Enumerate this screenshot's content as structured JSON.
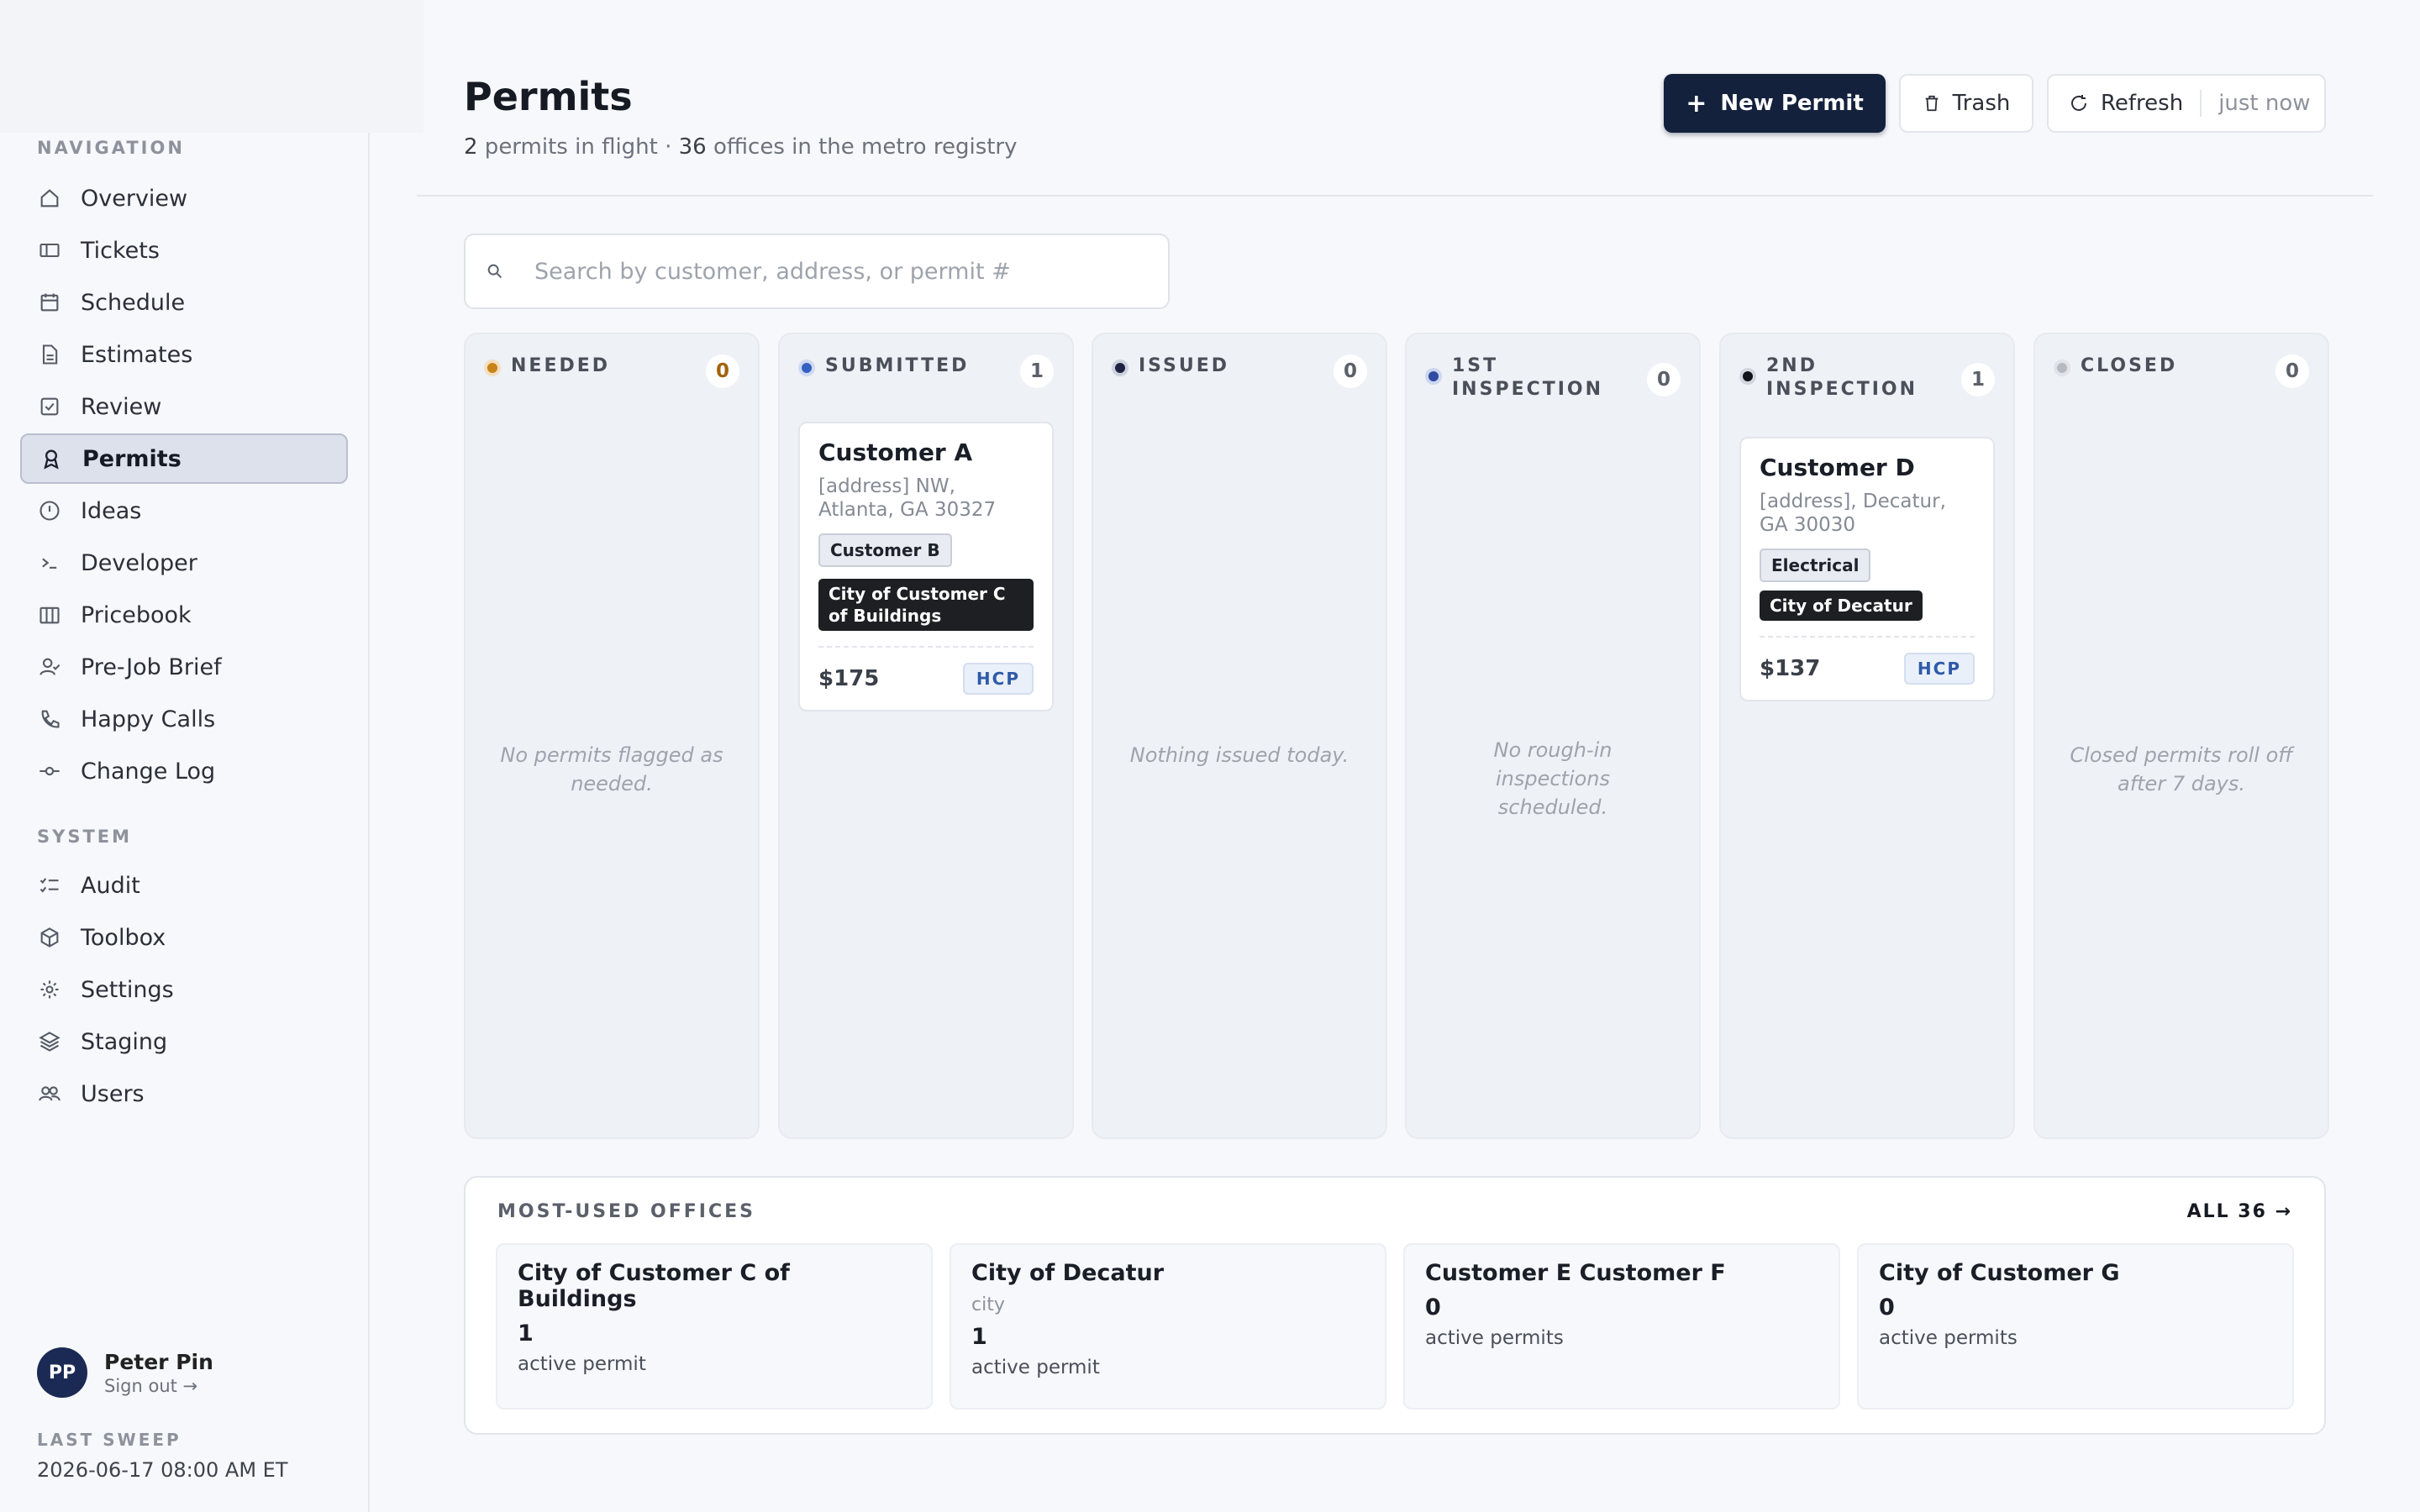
{
  "sidebar": {
    "nav_heading": "NAVIGATION",
    "items": [
      {
        "label": "Overview",
        "icon": "home-icon"
      },
      {
        "label": "Tickets",
        "icon": "ticket-icon"
      },
      {
        "label": "Schedule",
        "icon": "calendar-icon"
      },
      {
        "label": "Estimates",
        "icon": "document-icon"
      },
      {
        "label": "Review",
        "icon": "checkbox-icon"
      },
      {
        "label": "Permits",
        "icon": "badge-icon"
      },
      {
        "label": "Ideas",
        "icon": "clock-icon"
      },
      {
        "label": "Developer",
        "icon": "terminal-icon"
      },
      {
        "label": "Pricebook",
        "icon": "book-icon"
      },
      {
        "label": "Pre-Job Brief",
        "icon": "user-check-icon"
      },
      {
        "label": "Happy Calls",
        "icon": "phone-icon"
      },
      {
        "label": "Change Log",
        "icon": "commit-icon"
      }
    ],
    "system_heading": "SYSTEM",
    "system_items": [
      {
        "label": "Audit",
        "icon": "list-check-icon"
      },
      {
        "label": "Toolbox",
        "icon": "box-icon"
      },
      {
        "label": "Settings",
        "icon": "sun-gear-icon"
      },
      {
        "label": "Staging",
        "icon": "layers-icon"
      },
      {
        "label": "Users",
        "icon": "users-icon"
      }
    ],
    "active_item": "Permits",
    "user": {
      "initials": "PP",
      "name": "Peter Pin",
      "signout": "Sign out →"
    },
    "last_sweep_label": "LAST SWEEP",
    "last_sweep_value": "2026-06-17 08:00 AM ET"
  },
  "header": {
    "title": "Permits",
    "subtitle_count_permits": "2",
    "subtitle_mid": " permits in flight · ",
    "subtitle_count_offices": "36",
    "subtitle_end": " offices in the metro registry",
    "new_button": "New Permit",
    "trash_button": "Trash",
    "refresh_button": "Refresh",
    "refresh_status": "just now"
  },
  "search": {
    "placeholder": "Search by customer, address, or permit #"
  },
  "columns": [
    {
      "title": "NEEDED",
      "count": "0",
      "dot_color": "#c9821a",
      "count_color": "#a3620c",
      "empty": "No permits flagged as needed."
    },
    {
      "title": "SUBMITTED",
      "count": "1",
      "dot_color": "#3461c1",
      "count_color": "#5b606a"
    },
    {
      "title": "ISSUED",
      "count": "0",
      "dot_color": "#1b2340",
      "count_color": "#5b606a",
      "empty": "Nothing issued today."
    },
    {
      "title": "1ST INSPECTION",
      "count": "0",
      "dot_color": "#2f4aa0",
      "count_color": "#5b606a",
      "empty": "No rough-in inspections scheduled."
    },
    {
      "title": "2ND INSPECTION",
      "count": "1",
      "dot_color": "#111318",
      "count_color": "#5b606a"
    },
    {
      "title": "CLOSED",
      "count": "0",
      "dot_color": "#b5b9c1",
      "count_color": "#5b606a",
      "empty": "Closed permits roll off after 7 days."
    }
  ],
  "cards": [
    {
      "customer": "Customer A",
      "address": "[address] NW, Atlanta, GA 30327",
      "tag_light": "Customer B",
      "tag_dark": "City of Customer C of Buildings",
      "price": "$175",
      "source": "HCP"
    },
    {
      "customer": "Customer D",
      "address": "[address], Decatur, GA 30030",
      "tag_light": "Electrical",
      "tag_dark": "City of Decatur",
      "price": "$137",
      "source": "HCP"
    }
  ],
  "offices": {
    "label": "MOST-USED OFFICES",
    "all_link": "ALL 36 →",
    "items": [
      {
        "name": "City of Customer C of Buildings",
        "type": "",
        "count": "1",
        "unit": "active permit"
      },
      {
        "name": "City of Decatur",
        "type": "city",
        "count": "1",
        "unit": "active permit"
      },
      {
        "name": "Customer E Customer F",
        "type": "",
        "count": "0",
        "unit": "active permits"
      },
      {
        "name": "City of Customer G",
        "type": "",
        "count": "0",
        "unit": "active permits"
      }
    ]
  }
}
